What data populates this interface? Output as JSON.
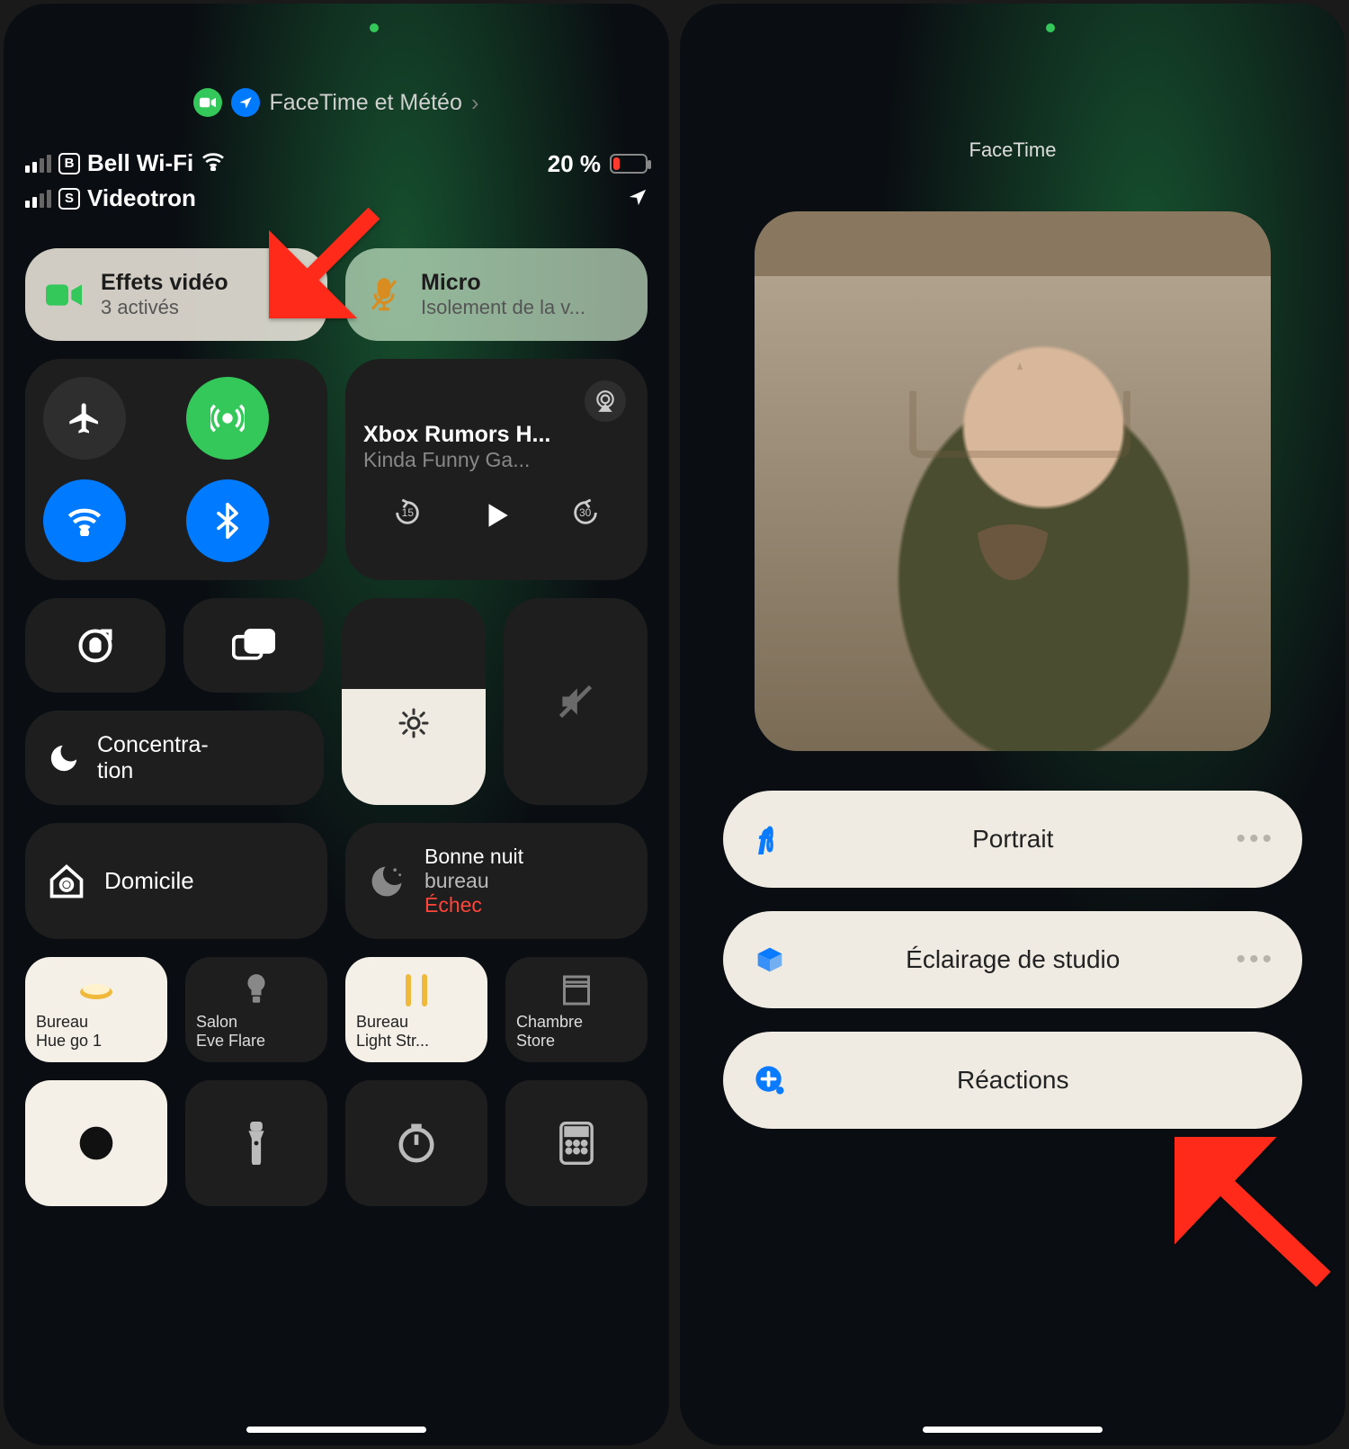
{
  "left": {
    "green_dot": true,
    "apps_pill": {
      "label": "FaceTime et Météo"
    },
    "status": {
      "carrier1": "Bell Wi-Fi",
      "sim1": "B",
      "carrier2": "Videotron",
      "sim2": "S",
      "battery_pct_label": "20 %",
      "battery_pct": 20
    },
    "cards": {
      "video_effects": {
        "title": "Effets vidéo",
        "sub": "3 activés"
      },
      "mic": {
        "title": "Micro",
        "sub": "Isolement de la v..."
      }
    },
    "media": {
      "title": "Xbox Rumors H...",
      "subtitle": "Kinda Funny Ga...",
      "back_s": "15",
      "fwd_s": "30"
    },
    "focus_label": "Concentra-\ntion",
    "home_tile": {
      "label": "Domicile"
    },
    "scene_tile": {
      "l1": "Bonne nuit",
      "l2": "bureau",
      "l3": "Échec"
    },
    "accessories": [
      {
        "name": "Bureau\nHue go 1",
        "on": true,
        "icon": "disc"
      },
      {
        "name": "Salon\nEve Flare",
        "on": false,
        "icon": "bulb"
      },
      {
        "name": "Bureau\nLight Str...",
        "on": true,
        "icon": "strip"
      },
      {
        "name": "Chambre\nStore",
        "on": false,
        "icon": "blind"
      }
    ]
  },
  "right": {
    "title": "FaceTime",
    "options": [
      {
        "label": "Portrait",
        "icon": "aperture",
        "icon_color": "#0a7bff",
        "dots": true
      },
      {
        "label": "Éclairage de studio",
        "icon": "cube",
        "icon_color": "#0a7bff",
        "dots": true
      },
      {
        "label": "Réactions",
        "icon": "plus-bubble",
        "icon_color": "#0a7bff",
        "dots": false
      }
    ]
  }
}
